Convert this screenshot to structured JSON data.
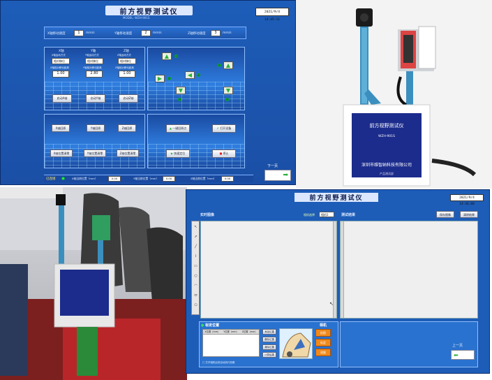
{
  "control": {
    "title": "前方视野测试仪",
    "subtitle": "MODEL: WZH-901S",
    "datetime": "2021/9/4 14:45:11",
    "speeds": [
      {
        "label": "X轴移动速度",
        "value": "1",
        "unit": "mm/s"
      },
      {
        "label": "Y轴移动速度",
        "value": "2",
        "unit": "mm/s"
      },
      {
        "label": "Z轴移动速度",
        "value": "3",
        "unit": "mm/s"
      }
    ],
    "axes": [
      {
        "name": "X轴",
        "mode_label": "X轴运动方式",
        "mode": "相对移位",
        "dist_label": "X轴相对移动距离",
        "value": "1.00",
        "btn": "启动X轴"
      },
      {
        "name": "Y轴",
        "mode_label": "Y轴运动方式",
        "mode": "相对移位",
        "dist_label": "Y轴相对移动距离",
        "value": "2.80",
        "btn": "启动Y轴"
      },
      {
        "name": "Z轴",
        "mode_label": "Z轴运动方式",
        "mode": "相对移位",
        "dist_label": "Z轴相对移动距离",
        "value": "1.00",
        "btn": "启动Z轴"
      }
    ],
    "reset_buttons": [
      "X轴回原",
      "Y轴回原",
      "Z轴回原",
      "X轴位置清零",
      "Y轴位置清零",
      "Z轴位置清零"
    ],
    "action_buttons": [
      "一键回原点",
      "打开设备",
      "快速定位",
      "停止"
    ],
    "status": {
      "label": "已连接",
      "x_label": "X轴当前位置（mm）",
      "x_value": "0.00",
      "y_label": "Y轴当前位置（mm）",
      "y_value": "0.00",
      "z_label": "Z轴当前位置（mm）",
      "z_value": "0.00"
    },
    "next_label": "下一页"
  },
  "device": {
    "title": "前方视野测试仪",
    "model": "WZH-901S",
    "company": "深圳市维智纳科技有限公司",
    "dept": "产品测试部"
  },
  "test": {
    "title": "前方视野测试仪",
    "datetime": "2021/9/4 14:46:08",
    "realtime_label": "实时图像",
    "camera_label": "相机选择",
    "camera_value": "相机1",
    "result_label": "测试结果",
    "save_btn": "保存图像",
    "clear_btn": "清除结果",
    "pose_label": "标定位置",
    "table_cols": [
      "X位置（mm）",
      "Y位置（mm）",
      "Z位置（mm）"
    ],
    "pose_buttons": [
      "添加位置",
      "删除位置",
      "清除位置",
      "计算结果"
    ],
    "camera_section": "相机",
    "cam_buttons": [
      "拍照",
      "标定",
      "测量"
    ],
    "footnote": "□ 打开相机后将自动执行拍照",
    "prev_label": "上一页"
  },
  "colors": {
    "panel": "#1d5db8",
    "accent_orange": "#f08a1c",
    "green": "#2bb03a"
  }
}
